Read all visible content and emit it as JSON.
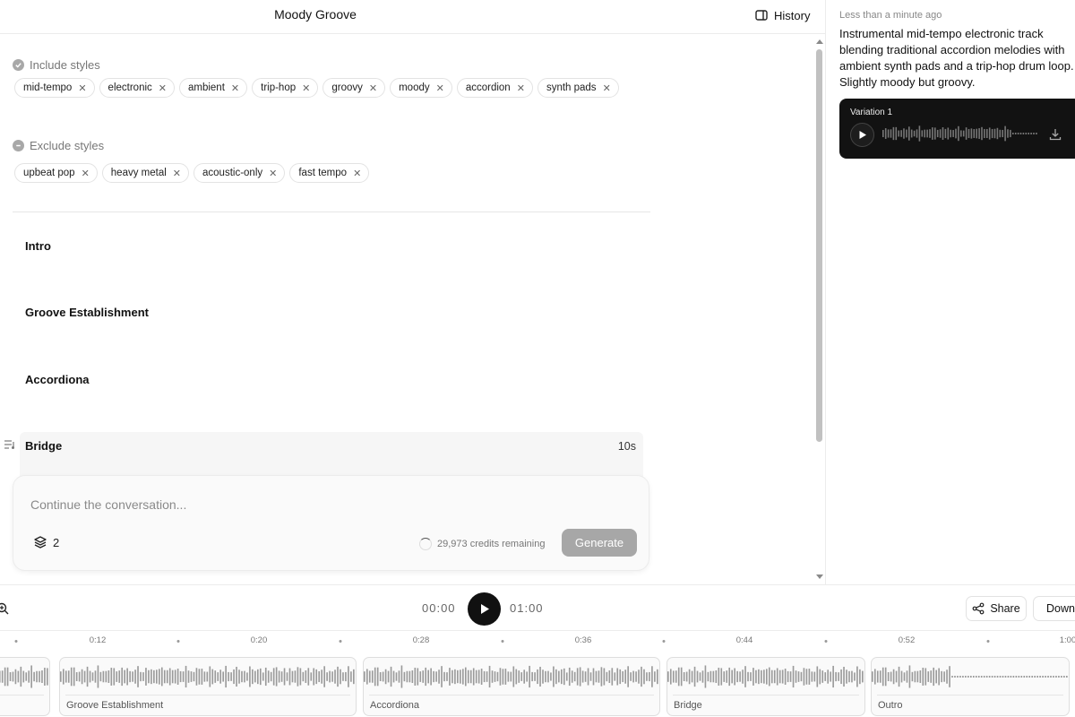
{
  "app": {
    "title": "Moody Groove",
    "history_label": "History"
  },
  "include": {
    "label": "Include styles",
    "tags": [
      "mid-tempo",
      "electronic",
      "ambient",
      "trip-hop",
      "groovy",
      "moody",
      "accordion",
      "synth pads"
    ]
  },
  "exclude": {
    "label": "Exclude styles",
    "tags": [
      "upbeat pop",
      "heavy metal",
      "acoustic-only",
      "fast tempo"
    ]
  },
  "sections": [
    {
      "name": "Intro"
    },
    {
      "name": "Groove Establishment"
    },
    {
      "name": "Accordiona"
    },
    {
      "name": "Bridge",
      "duration": "10s"
    }
  ],
  "composer": {
    "placeholder": "Continue the conversation...",
    "variations": "2",
    "credits": "29,973 credits remaining",
    "generate_label": "Generate"
  },
  "history": {
    "timestamp": "Less than a minute ago",
    "description_lines": [
      "Instrumental mid-tempo electronic track",
      "blending traditional accordion melodies with",
      "ambient synth pads and a trip-hop drum loop.",
      "Slightly moody but groovy."
    ],
    "variation_label": "Variation 1"
  },
  "player": {
    "current_time": "00:00",
    "total_time": "01:00",
    "share_label": "Share",
    "download_label": "Download"
  },
  "timeline": {
    "ticks": [
      "0:12",
      "0:20",
      "0:28",
      "0:36",
      "0:44",
      "0:52",
      "1:00"
    ],
    "segments": [
      "",
      "Groove Establishment",
      "Accordiona",
      "Bridge",
      "Outro"
    ]
  },
  "colors": {
    "accent": "#111111",
    "muted_button": "#a7a7a7",
    "card_dark": "#121212"
  },
  "icons": [
    "history-panel-icon",
    "include-check-icon",
    "exclude-minus-icon",
    "remove-tag-icon",
    "section-list-icon",
    "layers-icon",
    "spinner-icon",
    "play-icon",
    "download-icon",
    "zoom-icon",
    "share-icon"
  ]
}
